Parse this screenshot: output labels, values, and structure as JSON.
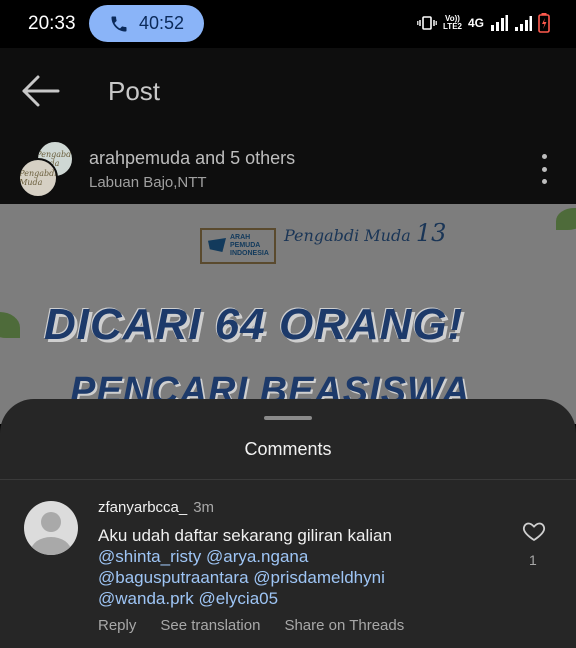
{
  "status_bar": {
    "time": "20:33",
    "call_duration": "40:52",
    "network_label": "4G",
    "volte_label_top": "Vo))",
    "volte_label_bottom": "LTE2"
  },
  "header": {
    "title": "Post"
  },
  "post": {
    "author": "arahpemuda and 5 others",
    "location": "Labuan Bajo,NTT",
    "avatar_text": "Pengabdi Muda",
    "image": {
      "logo_text": "ARAH PEMUDA INDONESIA",
      "program_name": "Pengabdi Muda",
      "program_number": "13",
      "headline": "DICARI 64 ORANG!",
      "subheadline": "PENCARI BEASISWA"
    }
  },
  "comments_sheet": {
    "title": "Comments",
    "comments": [
      {
        "username": "zfanyarbcca_",
        "time": "3m",
        "text_prefix": "Aku udah daftar sekarang giliran kalian",
        "mentions": [
          "@shinta_risty",
          "@arya.ngana",
          "@bagusputraantara",
          "@prisdameldhyni",
          "@wanda.prk",
          "@elycia05"
        ],
        "like_count": "1",
        "actions": {
          "reply": "Reply",
          "translate": "See translation",
          "share": "Share on Threads"
        }
      }
    ]
  },
  "colors": {
    "call_pill": "#8ab4f8",
    "sheet_background": "#262626",
    "mention": "#9ec5f5"
  }
}
